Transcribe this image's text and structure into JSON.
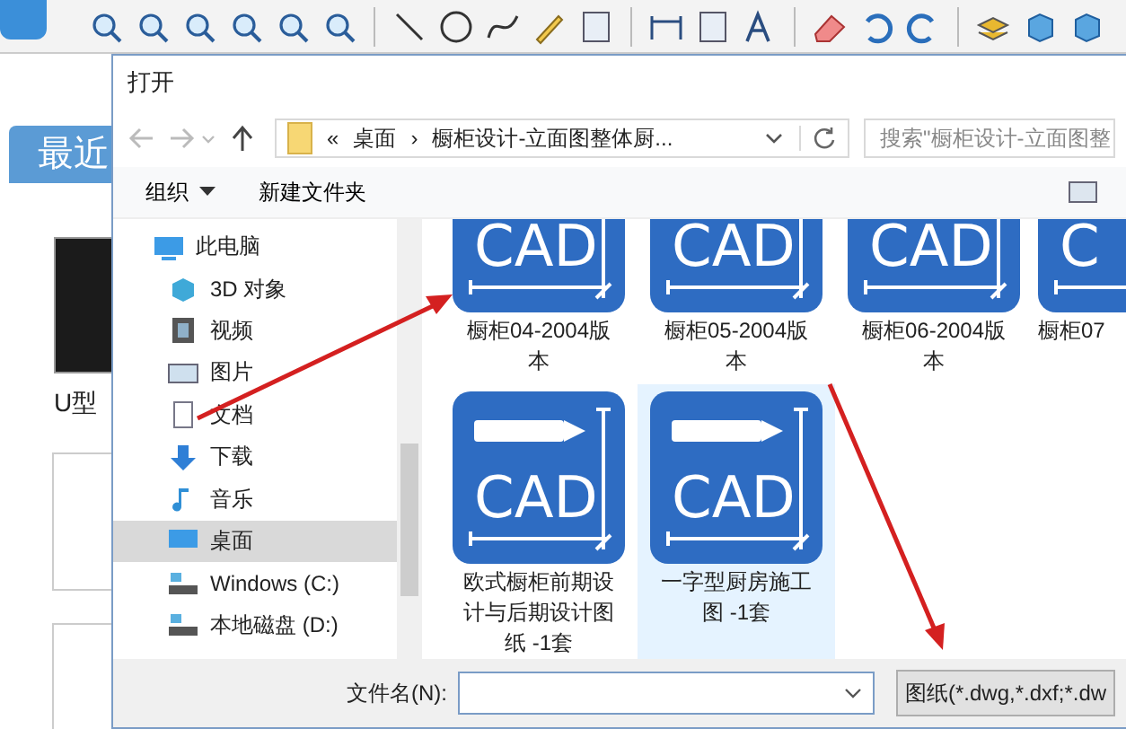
{
  "background_app": {
    "tab": "最近",
    "recent_file": "U型"
  },
  "dialog": {
    "title": "打开",
    "address": {
      "prefix": "«",
      "separator": "›",
      "crumbs": [
        "桌面",
        "橱柜设计-立面图整体厨..."
      ]
    },
    "search": {
      "placeholder": "搜索\"橱柜设计-立面图整"
    },
    "commands": [
      {
        "label": "组织",
        "dropdown": true
      },
      {
        "label": "新建文件夹",
        "dropdown": false
      }
    ],
    "sidebar": {
      "items": [
        {
          "label": "此电脑",
          "kind": "pc",
          "selected": false
        },
        {
          "label": "3D 对象",
          "kind": "cube",
          "selected": false
        },
        {
          "label": "视频",
          "kind": "video",
          "selected": false
        },
        {
          "label": "图片",
          "kind": "picture",
          "selected": false
        },
        {
          "label": "文档",
          "kind": "document",
          "selected": false
        },
        {
          "label": "下载",
          "kind": "download",
          "selected": false
        },
        {
          "label": "音乐",
          "kind": "music",
          "selected": false
        },
        {
          "label": "桌面",
          "kind": "desktop",
          "selected": true
        },
        {
          "label": "Windows (C:)",
          "kind": "drive",
          "selected": false
        },
        {
          "label": "本地磁盘 (D:)",
          "kind": "drive",
          "selected": false
        }
      ]
    },
    "files": [
      {
        "name": "橱柜04-2004版本",
        "icon_label": "CAD",
        "selected": false
      },
      {
        "name": "橱柜05-2004版本",
        "icon_label": "CAD",
        "selected": false
      },
      {
        "name": "橱柜06-2004版本",
        "icon_label": "CAD",
        "selected": false
      },
      {
        "name": "橱柜07",
        "icon_label": "C",
        "selected": false
      },
      {
        "name": "欧式橱柜前期设计与后期设计图纸 -1套",
        "icon_label": "CAD",
        "selected": false
      },
      {
        "name": "一字型厨房施工图 -1套",
        "icon_label": "CAD",
        "selected": true
      }
    ],
    "file_name": {
      "label": "文件名(N):"
    },
    "file_type": "图纸(*.dwg,*.dxf;*.dw"
  }
}
